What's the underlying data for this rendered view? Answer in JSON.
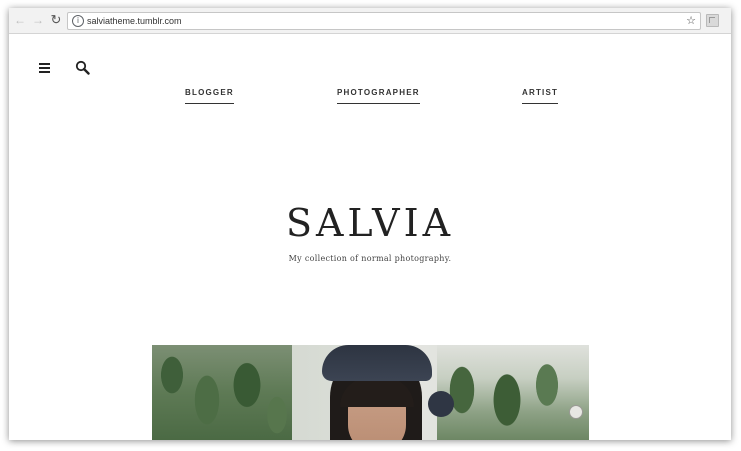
{
  "browser": {
    "back_icon": "arrow-left-icon",
    "forward_icon": "arrow-right-icon",
    "reload_icon": "reload-icon",
    "info_icon": "info-icon",
    "url": "salviatheme.tumblr.com",
    "star_icon": "star-outline-icon",
    "extension_icon": "extension-icon"
  },
  "header": {
    "menu_icon": "hamburger-menu-icon",
    "search_icon": "search-icon",
    "nav": [
      {
        "label": "BLOGGER"
      },
      {
        "label": "PHOTOGRAPHER"
      },
      {
        "label": "ARTIST"
      }
    ]
  },
  "hero": {
    "title": "SALVIA",
    "description": "My collection of normal photography."
  },
  "colors": {
    "text": "#222222",
    "toolbar": "#f2f2f2",
    "background": "#ffffff"
  }
}
